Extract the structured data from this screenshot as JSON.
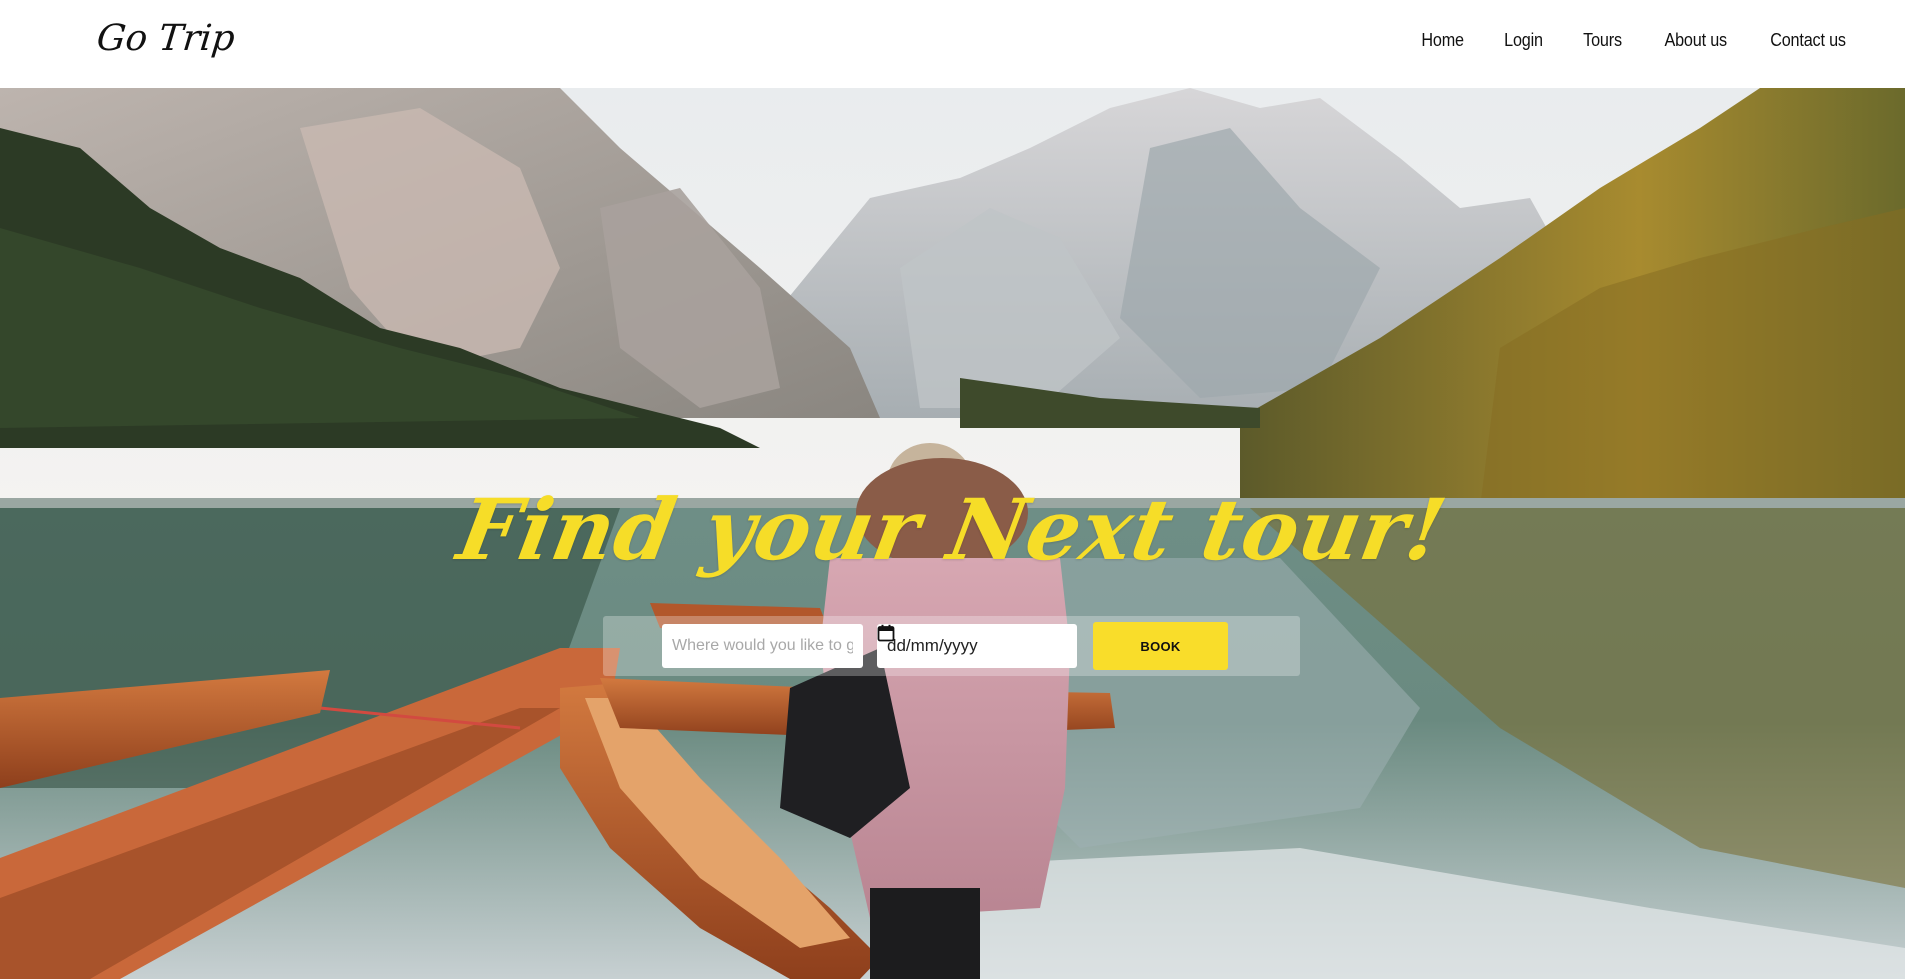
{
  "header": {
    "logo": "Go Trip",
    "nav": [
      {
        "label": "Home"
      },
      {
        "label": "Login"
      },
      {
        "label": "Tours"
      },
      {
        "label": "About us"
      },
      {
        "label": "Contact us"
      }
    ]
  },
  "hero": {
    "headline": "Find your Next tour!",
    "destination_placeholder": "Where would you like to go?",
    "destination_value": "",
    "date_placeholder": "dd/mm/yyyy",
    "book_label": "BOOK",
    "background_image": "mountain-lake-with-wooden-boats"
  },
  "colors": {
    "accent": "#f9dd2a",
    "headline": "#f6dd28",
    "header_bg": "#ffffff",
    "text": "#111111"
  }
}
